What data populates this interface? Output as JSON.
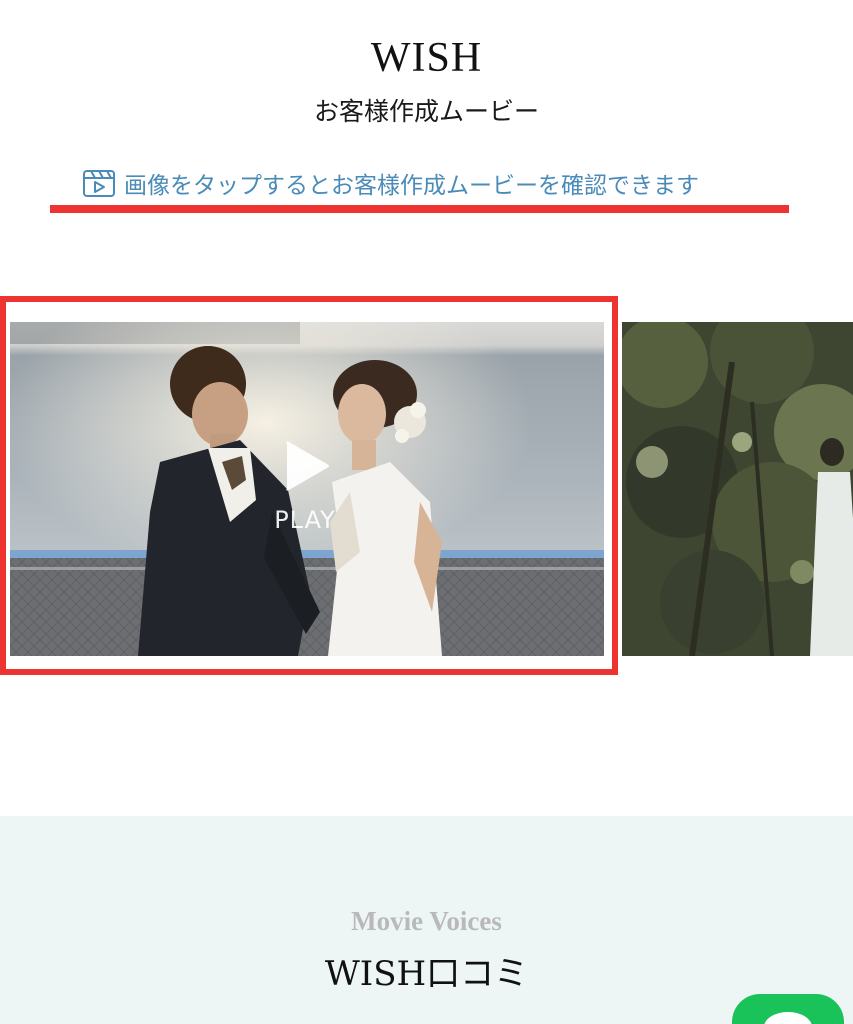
{
  "header": {
    "brand_title": "WISH",
    "brand_subtitle": "お客様作成ムービー"
  },
  "hint": {
    "text": "画像をタップするとお客様作成ムービーを確認できます",
    "icon": "video-clapper-icon",
    "color": "#4a8bb8"
  },
  "annotations": {
    "highlight_color": "#ee3430"
  },
  "carousel": {
    "play_label": "PLAY",
    "slides": [
      {
        "icon": "wedding-couple-photo"
      },
      {
        "icon": "bride-in-forest-photo"
      }
    ]
  },
  "voices": {
    "eyebrow": "Movie Voices",
    "title": "WISH口コミ",
    "background": "#edf6f5"
  },
  "fab": {
    "icon": "line-chat-icon",
    "color": "#19c35a"
  }
}
